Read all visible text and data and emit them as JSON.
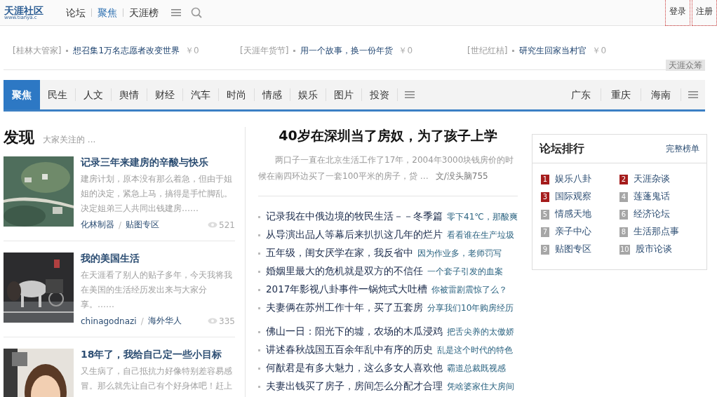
{
  "header": {
    "logo": "天涯社区",
    "logo_url": "www.tianya.c",
    "nav": [
      {
        "label": "论坛",
        "selected": false
      },
      {
        "label": "聚焦",
        "selected": true
      },
      {
        "label": "天涯榜",
        "selected": false
      }
    ],
    "account": [
      "登录",
      "注册"
    ]
  },
  "promos": [
    {
      "tag": "[桂林大管家]",
      "title": "想召集1万名志愿者改变世界",
      "amount": "￥0"
    },
    {
      "tag": "[天涯年货节]",
      "title": "用一个故事，换一份年货",
      "amount": "￥0"
    },
    {
      "tag": "[世纪红桔]",
      "title": "研究生回家当村官",
      "amount": "￥0"
    }
  ],
  "promo_badge": "天涯众筹",
  "channels": {
    "left": [
      {
        "label": "聚焦",
        "selected": true
      },
      {
        "label": "民生",
        "selected": false
      },
      {
        "label": "人文",
        "selected": false
      },
      {
        "label": "舆情",
        "selected": false
      },
      {
        "label": "财经",
        "selected": false
      },
      {
        "label": "汽车",
        "selected": false
      },
      {
        "label": "时尚",
        "selected": false
      },
      {
        "label": "情感",
        "selected": false
      },
      {
        "label": "娱乐",
        "selected": false
      },
      {
        "label": "图片",
        "selected": false
      },
      {
        "label": "投资",
        "selected": false
      }
    ],
    "right": [
      {
        "label": "广东",
        "selected": false
      },
      {
        "label": "重庆",
        "selected": false
      },
      {
        "label": "海南",
        "selected": false
      }
    ]
  },
  "discover": {
    "title": "发现",
    "subtitle": "大家关注的 ...",
    "items": [
      {
        "kind": "picture",
        "title": "记录三年来建房的辛酸与快乐",
        "body": "建房计划，原本没有那么着急，但由于姐姐的决定，紧急上马，搞得是手忙脚乱。决定姐弟三人共同出钱建房……",
        "author": "化林制器",
        "separator": "/",
        "board": "贴图专区",
        "views": "521"
      },
      {
        "kind": "picture",
        "title": "我的美国生活",
        "body": "在天涯看了别人的贴子多年，今天我将我在美国的生活经历发出来与大家分享。……",
        "author": "chinagodnazi",
        "separator": "/",
        "board": "海外华人",
        "views": "335"
      },
      {
        "kind": "picture",
        "title": "18年了，我给自己定一些小目标",
        "body": "又生病了，自己抵抗力好像特别差容易感冒。那么就先让自己有个好身体吧！赶上"
      }
    ]
  },
  "feature": {
    "title": "40岁在深圳当了房奴，为了孩子上学",
    "summary": "两口子一直在北京生活工作了17年，2004年3000块钱房价的时候在南四环边买了一套100平米的房子，贷 …",
    "byline": "文/没头脑755"
  },
  "headline_groups": [
    [
      {
        "title": "记录我在中俄边境的牧民生活－－冬季篇",
        "tag": "零下41℃，那酸爽"
      },
      {
        "title": "从导演出品人等幕后来扒扒这几年的烂片",
        "tag": "看看谁在生产垃圾"
      },
      {
        "title": "五年级，闺女厌学在家，我反省中",
        "tag": "因为作业多，老师罚写"
      },
      {
        "title": "婚姻里最大的危机就是双方的不信任",
        "tag": "一个套子引发的血案"
      },
      {
        "title": "2017年影视八卦事件一锅炖式大吐槽",
        "tag": "你被雷剧震惊了么？"
      },
      {
        "title": "夫妻俩在苏州工作十年，买了五套房",
        "tag": "分享我们10年购房经历"
      }
    ],
    [
      {
        "title": "佛山一日：阳光下的墟，农场的木瓜浸鸡",
        "tag": "把舌尖养的太傲娇"
      },
      {
        "title": "讲述春秋战国五百余年乱中有序的历史",
        "tag": "乱是这个时代的特色"
      },
      {
        "title": "何猷君是有多大魅力，这么多女人喜欢他",
        "tag": "霸道总裁既视感"
      },
      {
        "title": "夫妻出钱买了房子，房间怎么分配才合理",
        "tag": "凭啥婆家住大房间"
      }
    ]
  ],
  "ranking": {
    "title": "论坛排行",
    "more": "完整榜单",
    "items": [
      {
        "rank": "1",
        "name": "娱乐八卦",
        "color": "#a51c1c"
      },
      {
        "rank": "2",
        "name": "天涯杂谈",
        "color": "#a51c1c"
      },
      {
        "rank": "3",
        "name": "国际观察",
        "color": "#a51c1c"
      },
      {
        "rank": "4",
        "name": "莲蓬鬼话",
        "color": "#a6a6a6"
      },
      {
        "rank": "5",
        "name": "情感天地",
        "color": "#a6a6a6"
      },
      {
        "rank": "6",
        "name": "经济论坛",
        "color": "#a6a6a6"
      },
      {
        "rank": "7",
        "name": "亲子中心",
        "color": "#a6a6a6"
      },
      {
        "rank": "8",
        "name": "生活那点事",
        "color": "#a6a6a6"
      },
      {
        "rank": "9",
        "name": "贴图专区",
        "color": "#a6a6a6"
      },
      {
        "rank": "10",
        "name": "股市论谈",
        "color": "#a6a6a6"
      }
    ]
  }
}
